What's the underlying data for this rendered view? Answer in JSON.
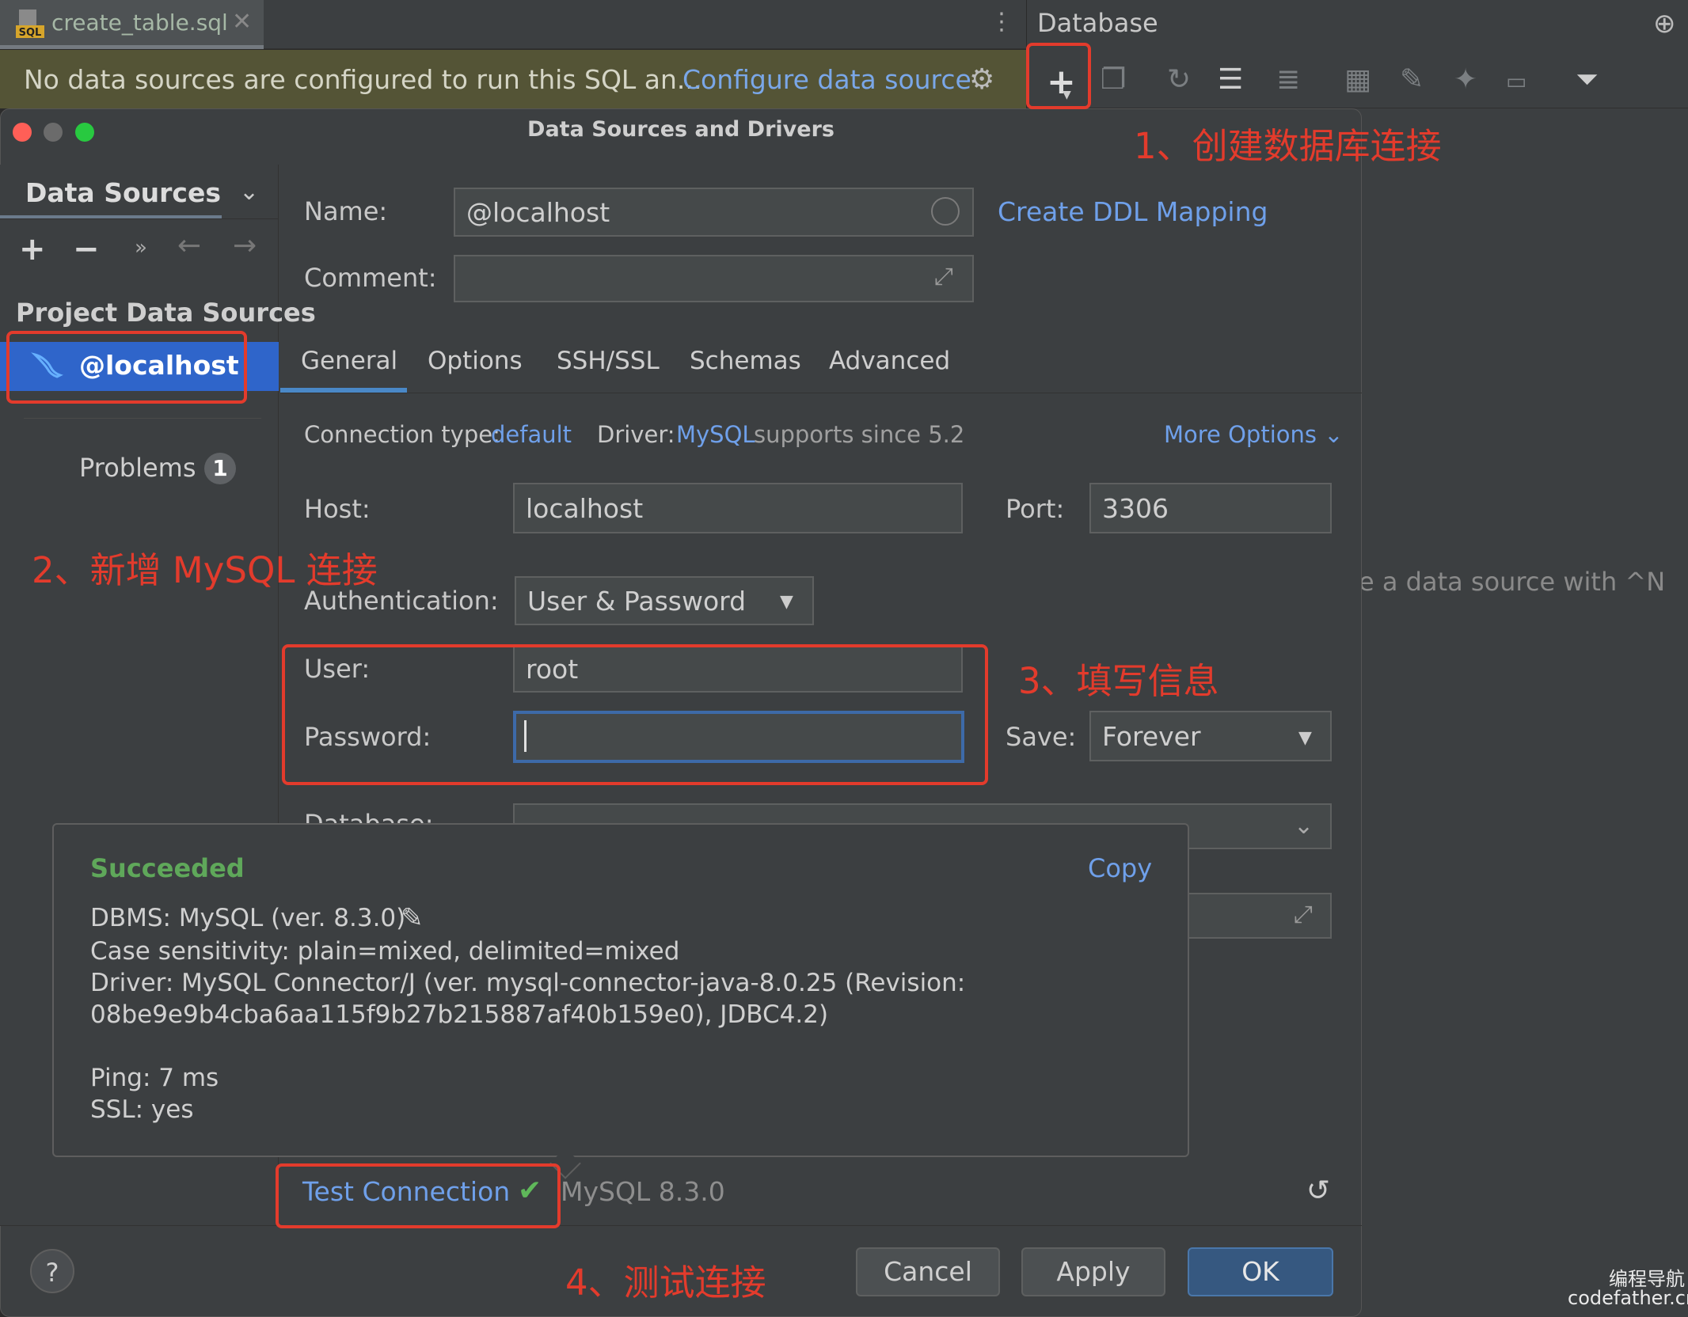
{
  "editor": {
    "file_tab": "create_table.sql",
    "notification_text": "No data sources are configured to run this SQL an...",
    "notification_link": "Configure data source"
  },
  "db_panel": {
    "title": "Database",
    "empty_hint": "e a data source with ^N"
  },
  "dialog": {
    "title": "Data Sources and Drivers",
    "left": {
      "tab": "Data Sources",
      "section": "Project Data Sources",
      "items": [
        {
          "label": "@localhost"
        }
      ],
      "problems_label": "Problems",
      "problems_count": "1"
    },
    "form": {
      "name_label": "Name:",
      "name_value": "@localhost",
      "ddl_link": "Create DDL Mapping",
      "comment_label": "Comment:",
      "tabs": [
        "General",
        "Options",
        "SSH/SSL",
        "Schemas",
        "Advanced"
      ],
      "connection_type_label": "Connection type:",
      "connection_type_value": "default",
      "driver_label": "Driver:",
      "driver_value": "MySQL",
      "driver_note": "supports since 5.2",
      "more_options": "More Options",
      "host_label": "Host:",
      "host_value": "localhost",
      "port_label": "Port:",
      "port_value": "3306",
      "auth_label": "Authentication:",
      "auth_value": "User & Password",
      "user_label": "User:",
      "user_value": "root",
      "password_label": "Password:",
      "save_label": "Save:",
      "save_value": "Forever",
      "database_label": "Database:"
    },
    "popup": {
      "status": "Succeeded",
      "copy": "Copy",
      "lines": [
        "DBMS: MySQL (ver. 8.3.0)",
        "Case sensitivity: plain=mixed, delimited=mixed",
        "Driver: MySQL Connector/J (ver. mysql-connector-java-8.0.25 (Revision:",
        "08be9e9b4cba6aa115f9b27b215887af40b159e0), JDBC4.2)",
        "Ping: 7 ms",
        "SSL: yes"
      ]
    },
    "test_connection": "Test Connection",
    "test_version": "MySQL 8.3.0",
    "buttons": {
      "help": "?",
      "cancel": "Cancel",
      "apply": "Apply",
      "ok": "OK"
    }
  },
  "annotations": {
    "step1": "1、创建数据库连接",
    "step2": "2、新增 MySQL 连接",
    "step3": "3、填写信息",
    "step4": "4、测试连接"
  },
  "watermark": {
    "line1": "编程导航",
    "line2": "codefather.cn"
  },
  "colors": {
    "accent_link": "#6fa0ea",
    "selection": "#2f65ca",
    "success": "#5fa85a",
    "annotation": "#e33b2c"
  }
}
